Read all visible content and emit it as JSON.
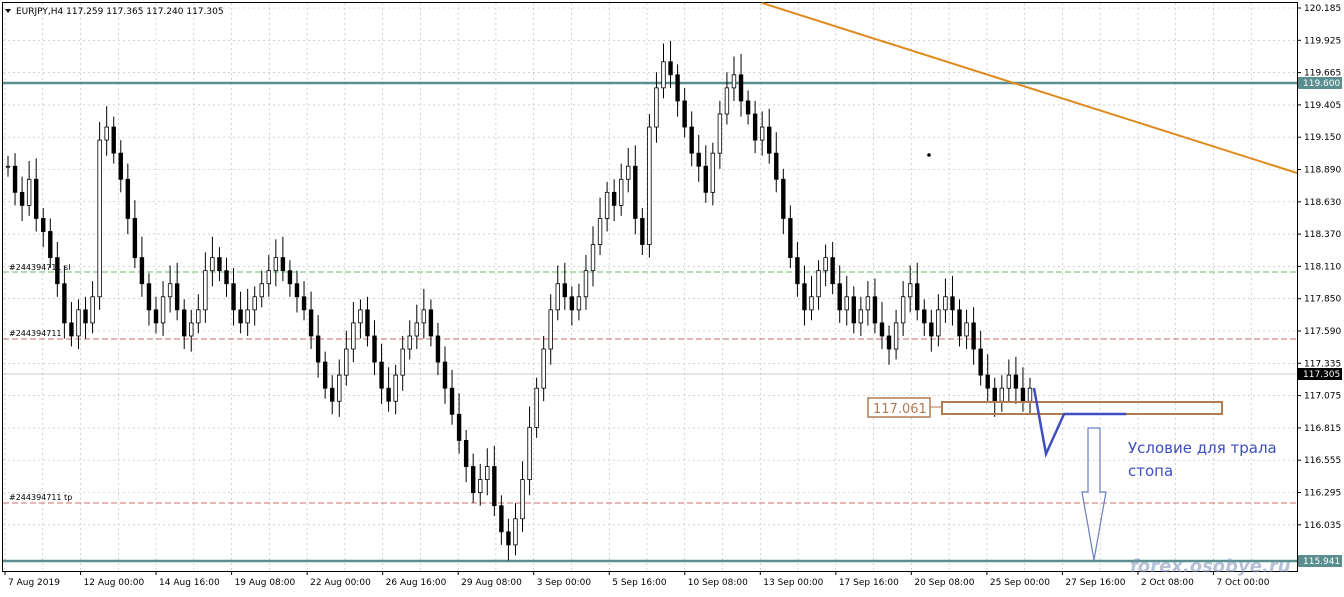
{
  "window": {
    "symbol_title": "EURJPY,H4  117.259 117.365 117.240 117.305"
  },
  "colors": {
    "background": "#ffffff",
    "grid": "#b8b8b8",
    "candle": "#000000",
    "level": "#5b8f8f",
    "trendline": "#e08a1e",
    "order_line": "#c04040",
    "green_line": "#3e9a3e",
    "annotation": "#3d4ec0",
    "box": "#b07a52",
    "current_price_bg": "#000000",
    "level_label_bg": "#5b8f8f"
  },
  "price_axis": {
    "ticks": [
      "120.185",
      "119.925",
      "119.665",
      "119.405",
      "119.150",
      "118.890",
      "118.630",
      "118.370",
      "118.110",
      "117.850",
      "117.590",
      "117.335",
      "117.075",
      "116.815",
      "116.555",
      "116.295",
      "116.035"
    ],
    "level_labels": {
      "upper": "119.600",
      "lower": "115.941"
    },
    "current_price": "117.305"
  },
  "time_axis": {
    "labels": [
      "7 Aug 2019",
      "12 Aug 00:00",
      "14 Aug 16:00",
      "19 Aug 08:00",
      "22 Aug 00:00",
      "26 Aug 16:00",
      "29 Aug 08:00",
      "3 Sep 00:00",
      "5 Sep 16:00",
      "10 Sep 08:00",
      "13 Sep 00:00",
      "17 Sep 16:00",
      "20 Sep 08:00",
      "25 Sep 00:00",
      "27 Sep 16:00",
      "2 Oct 08:00",
      "7 Oct 00:00"
    ]
  },
  "orders": {
    "sl_label": "#244394711 sl",
    "entry_label": "#244394711",
    "tp_label": "#244394711 tp"
  },
  "annotations": {
    "price_box": "117.061",
    "note": [
      "Условие для трала",
      "стопа"
    ],
    "watermark": "forex.osobye.ru"
  },
  "chart_data": {
    "type": "candlestick",
    "title": "EURJPY,H4  117.259 117.365 117.240 117.305",
    "ylim": [
      115.9,
      120.25
    ],
    "levels": [
      119.6,
      115.941
    ],
    "order_lines": {
      "sl": 118.12,
      "entry": 117.59,
      "tp": 116.3
    },
    "trendline": {
      "from": [
        "13 Sep",
        120.19
      ],
      "to": [
        "9 Oct",
        119.11
      ]
    },
    "grid": true,
    "close_series": [
      119.0,
      118.8,
      118.7,
      118.9,
      118.6,
      118.5,
      118.3,
      118.1,
      117.8,
      117.7,
      117.9,
      117.8,
      118.0,
      119.2,
      119.3,
      119.1,
      118.9,
      118.6,
      118.3,
      118.1,
      117.9,
      117.8,
      118.0,
      118.1,
      117.9,
      117.7,
      117.8,
      117.9,
      118.2,
      118.3,
      118.2,
      118.1,
      117.9,
      117.8,
      117.9,
      118.0,
      118.1,
      118.2,
      118.3,
      118.2,
      118.1,
      118.0,
      117.9,
      117.7,
      117.5,
      117.3,
      117.2,
      117.4,
      117.6,
      117.8,
      117.9,
      117.7,
      117.5,
      117.3,
      117.2,
      117.4,
      117.6,
      117.7,
      117.8,
      117.9,
      117.7,
      117.5,
      117.3,
      117.1,
      116.9,
      116.7,
      116.5,
      116.6,
      116.7,
      116.4,
      116.2,
      116.1,
      116.3,
      116.6,
      117.0,
      117.3,
      117.6,
      117.9,
      118.1,
      118.0,
      117.9,
      118.0,
      118.2,
      118.4,
      118.6,
      118.8,
      118.7,
      118.9,
      119.0,
      118.6,
      118.4,
      119.3,
      119.6,
      119.8,
      119.7,
      119.5,
      119.3,
      119.1,
      119.0,
      118.8,
      119.1,
      119.4,
      119.6,
      119.7,
      119.5,
      119.4,
      119.2,
      119.3,
      119.1,
      118.9,
      118.6,
      118.3,
      118.1,
      117.9,
      118.0,
      118.2,
      118.3,
      118.1,
      117.9,
      118.0,
      117.8,
      117.9,
      118.0,
      117.8,
      117.7,
      117.6,
      117.8,
      118.0,
      118.1,
      117.9,
      117.8,
      117.7,
      117.9,
      118.0,
      117.9,
      117.7,
      117.8,
      117.6,
      117.4,
      117.3,
      117.2,
      117.3,
      117.4,
      117.3,
      117.2,
      117.3
    ]
  }
}
